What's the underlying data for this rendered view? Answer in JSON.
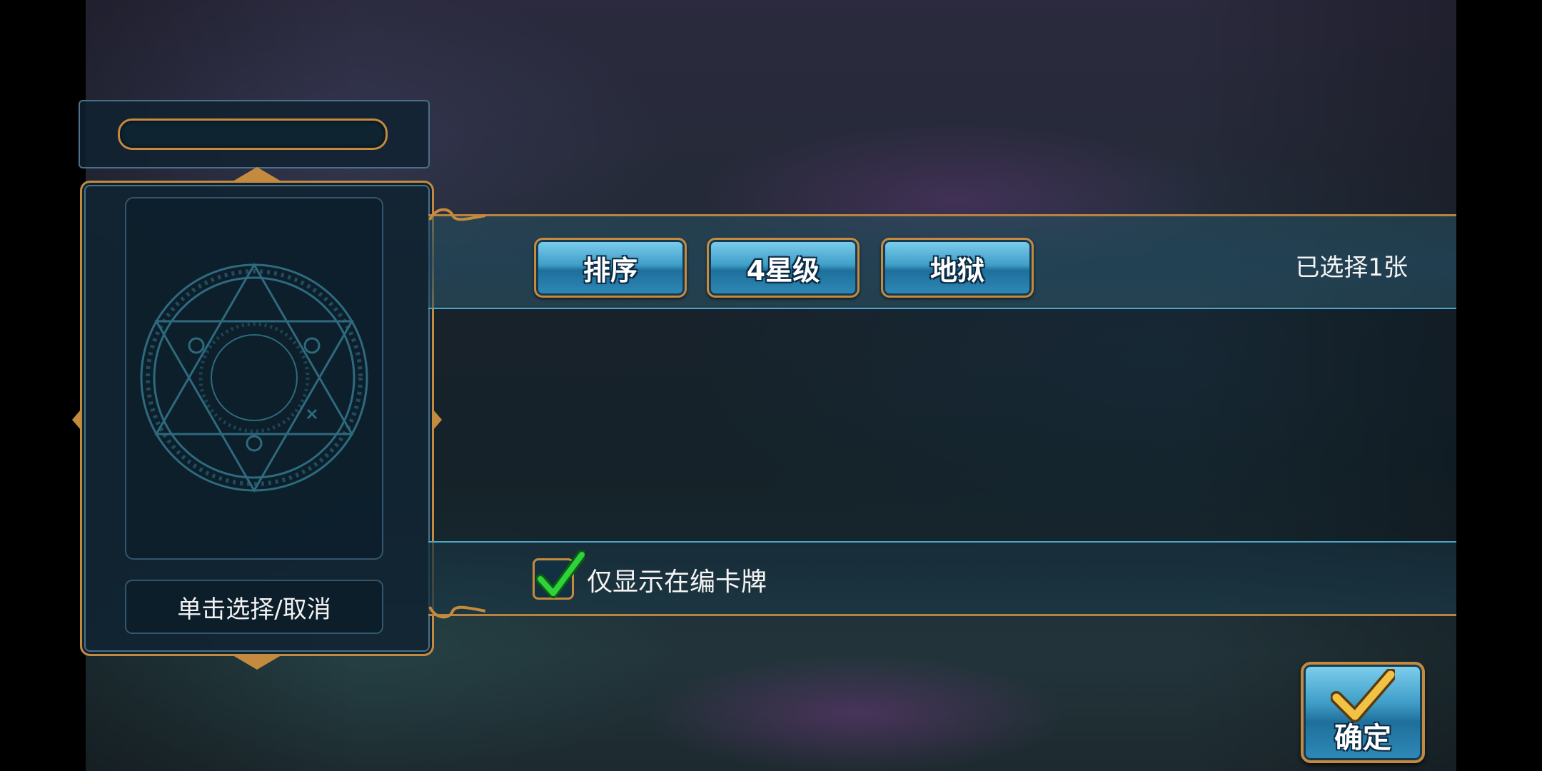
{
  "buttons": {
    "sort": "排序",
    "star_filter": "4星级",
    "region_filter": "地狱"
  },
  "selected_count": "已选择1张",
  "card_hint": "单击选择/取消",
  "show_in_deck_only": {
    "label": "仅显示在编卡牌",
    "checked": true
  },
  "confirm_label": "确定",
  "colors": {
    "gold_border": "#c48a3e",
    "button_blue": "#3f9ec8",
    "check_green": "#2fd23a"
  },
  "icons": {
    "magic_circle": "hexagram-magic-circle-icon",
    "check": "checkmark-icon",
    "confirm": "gold-checkmark-icon"
  }
}
